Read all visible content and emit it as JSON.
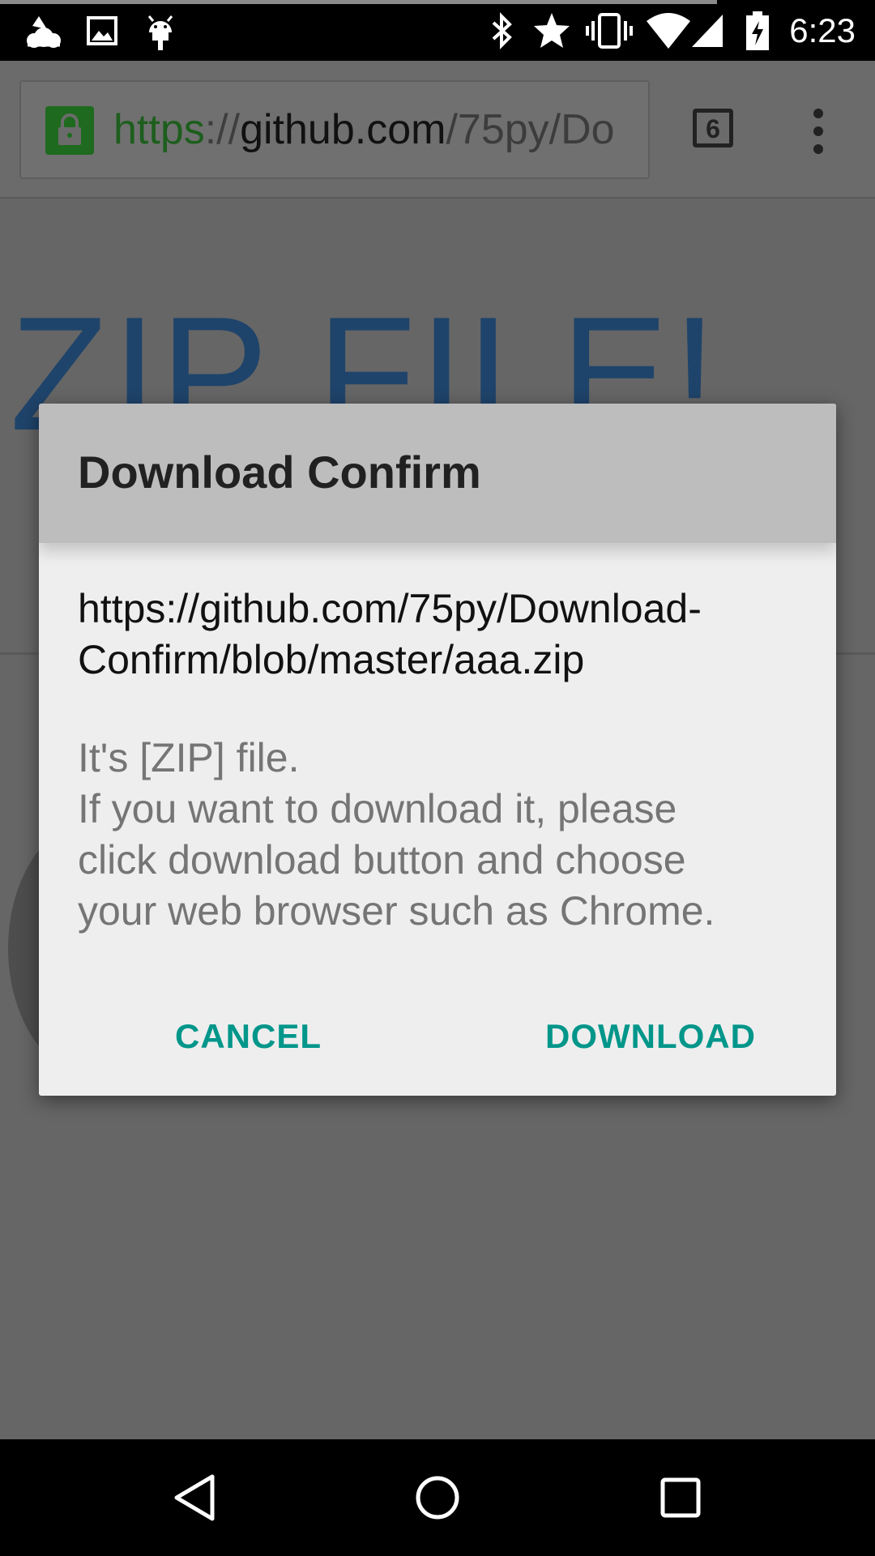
{
  "status_bar": {
    "time": "6:23",
    "icons": [
      "weather-icon",
      "image-icon",
      "android-icon",
      "bluetooth-icon",
      "star-icon",
      "vibrate-icon",
      "wifi-icon",
      "signal-icon",
      "battery-charging-icon"
    ]
  },
  "browser": {
    "url_scheme": "https",
    "url_separator": "://",
    "url_host": "github.com",
    "url_path": "/75py/Do",
    "tab_count": "6",
    "icons": [
      "lock-icon",
      "tab-switcher-icon",
      "overflow-menu-icon"
    ]
  },
  "page": {
    "heading": "ZIP FILE!"
  },
  "dialog": {
    "title": "Download Confirm",
    "url": "https://github.com/75py/Download-Confirm/blob/master/aaa.zip",
    "message_lines": [
      "It's [ZIP] file.",
      "If you want to download it, please",
      "click download button and choose",
      "your web browser such as Chrome."
    ],
    "cancel_label": "CANCEL",
    "download_label": "DOWNLOAD"
  },
  "nav_bar": {
    "icons": [
      "back-icon",
      "home-icon",
      "recents-icon"
    ]
  },
  "colors": {
    "accent": "#00968a",
    "secure_green": "#1d5e1d",
    "heading_blue": "#1f446b"
  }
}
